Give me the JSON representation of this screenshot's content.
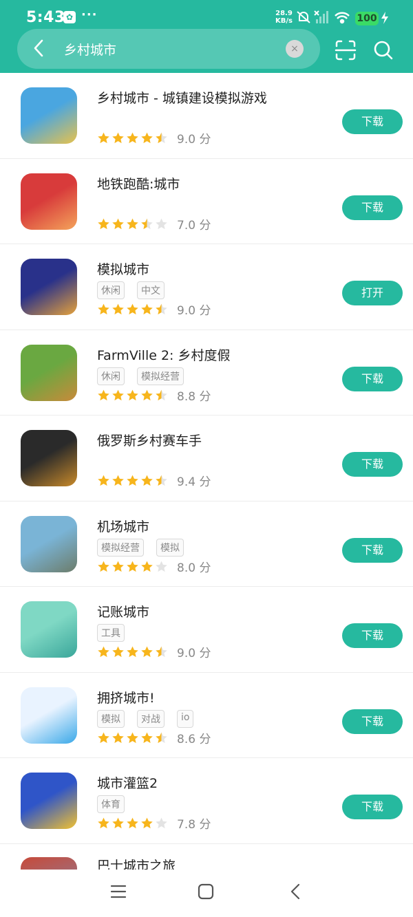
{
  "status": {
    "time": "5:43",
    "dots": "···",
    "net_speed_value": "28.9",
    "net_speed_unit": "KB/s",
    "battery": "100"
  },
  "search": {
    "query": "乡村城市",
    "clear_symbol": "×"
  },
  "results": [
    {
      "name": "乡村城市 - 城镇建设模拟游戏",
      "tags": [],
      "stars": 4.5,
      "score": "9.0 分",
      "button": "下载",
      "icon_colors": [
        "#4aa6e0",
        "#e7c24d"
      ]
    },
    {
      "name": "地铁跑酷:城市",
      "tags": [],
      "stars": 3.5,
      "score": "7.0 分",
      "button": "下载",
      "icon_colors": [
        "#d83b3b",
        "#f4a45b"
      ]
    },
    {
      "name": "模拟城市",
      "tags": [
        "休闲",
        "中文"
      ],
      "stars": 4.5,
      "score": "9.0 分",
      "button": "打开",
      "icon_colors": [
        "#29318a",
        "#e6a23b"
      ]
    },
    {
      "name": "FarmVille 2: 乡村度假",
      "tags": [
        "休闲",
        "模拟经营"
      ],
      "stars": 4.5,
      "score": "8.8 分",
      "button": "下载",
      "icon_colors": [
        "#6aa841",
        "#c98a3a"
      ]
    },
    {
      "name": "俄罗斯乡村赛车手",
      "tags": [],
      "stars": 4.5,
      "score": "9.4 分",
      "button": "下载",
      "icon_colors": [
        "#2a2a2a",
        "#c98a2a"
      ]
    },
    {
      "name": "机场城市",
      "tags": [
        "模拟经营",
        "模拟"
      ],
      "stars": 4,
      "score": "8.0 分",
      "button": "下载",
      "icon_colors": [
        "#7ab4d6",
        "#6c7c6a"
      ]
    },
    {
      "name": "记账城市",
      "tags": [
        "工具"
      ],
      "stars": 4.5,
      "score": "9.0 分",
      "button": "下载",
      "icon_colors": [
        "#7fd8c4",
        "#3aa69a"
      ]
    },
    {
      "name": "拥挤城市!",
      "tags": [
        "模拟",
        "对战",
        "io"
      ],
      "stars": 4.5,
      "score": "8.6 分",
      "button": "下载",
      "icon_colors": [
        "#e9f3ff",
        "#3aa8e8"
      ]
    },
    {
      "name": "城市灌篮2",
      "tags": [
        "体育"
      ],
      "stars": 4,
      "score": "7.8 分",
      "button": "下载",
      "icon_colors": [
        "#2f55c8",
        "#f2c230"
      ]
    }
  ],
  "partial_item": {
    "name": "巴士城市之旅"
  },
  "colors": {
    "accent": "#26b99f",
    "star": "#f7b51c",
    "star_empty": "#e3e3e3"
  }
}
